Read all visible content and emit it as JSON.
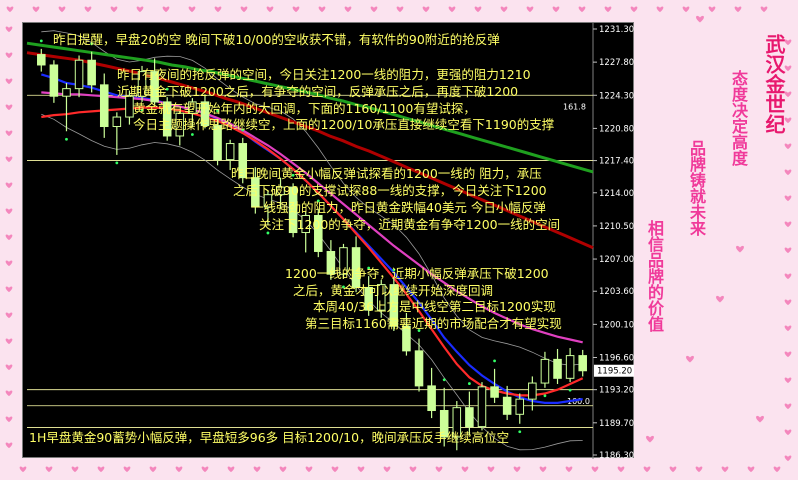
{
  "annotations": {
    "top_line": "昨日提醒，早盘20的空 晚间下破10/00的空收获不错，有软件的90附近的抢反弹",
    "para1": [
      "昨日有夜间的抢反弹的空间，今日关注1200一线的阻力，更强的阻力1210",
      "近期黄金下破1200之后，有争夺的空间，反弹承压之后，再度下破1200",
      "黄金就有望开始年内的大回调，下面的1160/1100有望试探，",
      "今日主题操作思路继续空，上面的1200/10承压直接继续空看下1190的支撑"
    ],
    "para2": [
      "昨日晚间黄金小幅反弹试探看的1200一线的 阻力，承压",
      "之后下破90的支撑试探88一线的支撑，今日关注下1200",
      "一线强劲的阻力，昨日黄金跌幅40美元 今日小幅反弹",
      "关注下1200的争夺，近期黄金有争夺1200一线的空间"
    ],
    "para3": [
      "1200一线的争夺，近期小幅反弹承压下破1200",
      "之后，黄金才可以继续开始深度回调",
      "本周40/36上方是中线空第二目标1200实现",
      "第三目标1160需要近期的市场配合才有望实现"
    ],
    "bottom_line": "1H早盘黄金90蓄势小幅反弹，早盘短多96多 目标1200/10，晚间承压反手继续高位空"
  },
  "slogans": {
    "s1": "武汉金世纪",
    "s2": "态度决定高度",
    "s3": "品牌铸就未来",
    "s4": "相信品牌的价值"
  },
  "colors": {
    "background": "#fbe3ef",
    "chart_bg": "#000000",
    "candle": "#ccff99",
    "bull_fill": "#000000",
    "ma_blue": "#1a2cff",
    "ma_red": "#ff2a2a",
    "ma_magenta": "#e040c0",
    "ma_green": "#1fa01f",
    "ma_darkred": "#b00000",
    "price_line": "#ffff00",
    "slogan_red": "#e8186e",
    "slogan_pink": "#f03a9a"
  },
  "chart_data": {
    "type": "candlestick",
    "timeframe": "1H",
    "y_ticks": [
      "1231.30",
      "1227.80",
      "1224.30",
      "1220.80",
      "1217.40",
      "1214.00",
      "1210.50",
      "1207.00",
      "1203.60",
      "1200.10",
      "1196.60",
      "1193.20",
      "1189.70",
      "1186.30"
    ],
    "ylim": [
      1186.3,
      1231.3
    ],
    "current_price_label": "1195.20",
    "level_label_100": "100.0",
    "level_label_right": "161.8",
    "horizontal_levels": [
      1224.3,
      1217.4,
      1193.2,
      1191.5,
      1189.2
    ],
    "candles": [
      [
        1228.6,
        1229.2,
        1226.8,
        1227.5
      ],
      [
        1227.5,
        1228.0,
        1223.5,
        1224.2
      ],
      [
        1224.2,
        1225.6,
        1220.5,
        1225.0
      ],
      [
        1225.0,
        1228.5,
        1224.1,
        1228.0
      ],
      [
        1228.0,
        1228.9,
        1224.6,
        1225.4
      ],
      [
        1225.4,
        1226.6,
        1219.8,
        1221.0
      ],
      [
        1221.0,
        1222.5,
        1218.0,
        1222.0
      ],
      [
        1222.0,
        1224.8,
        1221.2,
        1224.2
      ],
      [
        1224.2,
        1227.4,
        1223.6,
        1226.8
      ],
      [
        1226.8,
        1228.2,
        1223.3,
        1223.6
      ],
      [
        1223.6,
        1224.1,
        1219.5,
        1220.0
      ],
      [
        1220.0,
        1222.6,
        1219.0,
        1222.4
      ],
      [
        1222.4,
        1224.0,
        1221.0,
        1223.6
      ],
      [
        1223.6,
        1224.4,
        1220.8,
        1221.1
      ],
      [
        1221.1,
        1221.8,
        1216.9,
        1217.5
      ],
      [
        1217.5,
        1219.6,
        1216.4,
        1219.2
      ],
      [
        1219.2,
        1219.8,
        1215.0,
        1215.6
      ],
      [
        1215.6,
        1216.7,
        1211.8,
        1212.5
      ],
      [
        1212.5,
        1214.2,
        1210.6,
        1213.8
      ],
      [
        1213.8,
        1215.6,
        1212.3,
        1214.6
      ],
      [
        1214.6,
        1215.0,
        1209.3,
        1209.8
      ],
      [
        1209.8,
        1212.0,
        1207.7,
        1211.6
      ],
      [
        1211.6,
        1212.3,
        1207.2,
        1207.8
      ],
      [
        1207.8,
        1209.0,
        1204.8,
        1205.4
      ],
      [
        1205.4,
        1208.6,
        1204.9,
        1208.2
      ],
      [
        1208.2,
        1209.4,
        1203.5,
        1204.0
      ],
      [
        1204.0,
        1205.2,
        1201.0,
        1201.6
      ],
      [
        1201.6,
        1204.8,
        1200.8,
        1204.3
      ],
      [
        1204.3,
        1205.0,
        1199.4,
        1199.9
      ],
      [
        1199.9,
        1201.3,
        1196.8,
        1197.3
      ],
      [
        1197.3,
        1198.6,
        1193.0,
        1193.6
      ],
      [
        1193.6,
        1195.5,
        1190.2,
        1191.0
      ],
      [
        1191.0,
        1193.4,
        1187.2,
        1188.2
      ],
      [
        1188.2,
        1192.0,
        1186.8,
        1191.3
      ],
      [
        1191.3,
        1193.0,
        1188.4,
        1189.3
      ],
      [
        1189.3,
        1194.0,
        1188.9,
        1193.5
      ],
      [
        1193.5,
        1195.4,
        1191.8,
        1192.4
      ],
      [
        1192.4,
        1193.6,
        1190.0,
        1190.6
      ],
      [
        1190.6,
        1192.8,
        1189.6,
        1192.2
      ],
      [
        1192.2,
        1194.6,
        1191.0,
        1193.9
      ],
      [
        1193.9,
        1197.2,
        1193.4,
        1196.4
      ],
      [
        1196.4,
        1197.5,
        1193.8,
        1194.4
      ],
      [
        1194.4,
        1197.6,
        1194.0,
        1196.8
      ],
      [
        1196.8,
        1197.4,
        1194.6,
        1195.2
      ]
    ],
    "ma_lines": [
      {
        "name": "MA-blue",
        "color": "#1a2cff",
        "values": [
          1226.5,
          1226.1,
          1225.6,
          1225.4,
          1225.1,
          1224.7,
          1224.3,
          1224.1,
          1224.0,
          1223.8,
          1223.4,
          1223.1,
          1222.8,
          1222.4,
          1221.8,
          1221.2,
          1220.4,
          1219.4,
          1218.5,
          1217.6,
          1216.5,
          1215.3,
          1214.0,
          1212.6,
          1211.2,
          1209.8,
          1208.4,
          1207.0,
          1205.6,
          1204.0,
          1202.4,
          1200.6,
          1198.7,
          1197.2,
          1195.8,
          1194.7,
          1193.8,
          1193.0,
          1192.4,
          1192.0,
          1191.8,
          1191.8,
          1192.0,
          1192.2
        ]
      },
      {
        "name": "MA-red",
        "color": "#ff2a2a",
        "values": [
          1222.0,
          1222.2,
          1222.3,
          1222.5,
          1222.6,
          1222.7,
          1222.8,
          1222.9,
          1223.0,
          1223.0,
          1222.9,
          1222.7,
          1222.4,
          1222.0,
          1221.6,
          1221.0,
          1220.3,
          1219.5,
          1218.6,
          1217.6,
          1216.5,
          1215.3,
          1214.0,
          1212.6,
          1211.2,
          1209.7,
          1208.2,
          1206.6,
          1205.0,
          1203.3,
          1201.5,
          1199.6,
          1197.7,
          1195.9,
          1194.5,
          1193.6,
          1193.1,
          1192.8,
          1192.6,
          1192.6,
          1192.8,
          1193.2,
          1193.8,
          1194.4
        ]
      },
      {
        "name": "MA-magenta",
        "color": "#e040c0",
        "values": [
          1224.6,
          1224.5,
          1224.4,
          1224.4,
          1224.3,
          1224.2,
          1224.1,
          1224.0,
          1223.9,
          1223.7,
          1223.4,
          1223.1,
          1222.8,
          1222.4,
          1221.9,
          1221.3,
          1220.6,
          1219.8,
          1219.0,
          1218.1,
          1217.1,
          1216.1,
          1215.0,
          1213.9,
          1212.8,
          1211.7,
          1210.6,
          1209.5,
          1208.4,
          1207.4,
          1206.4,
          1205.4,
          1204.5,
          1203.6,
          1202.8,
          1202.0,
          1201.3,
          1200.7,
          1200.1,
          1199.6,
          1199.2,
          1198.8,
          1198.5,
          1198.2
        ]
      },
      {
        "name": "MA-green",
        "color": "#1fa01f",
        "values": [
          1229.8,
          1229.6,
          1229.4,
          1229.2,
          1229.0,
          1228.8,
          1228.6,
          1228.4,
          1228.2,
          1228.0,
          1227.8,
          1227.5,
          1227.3,
          1227.0,
          1226.8,
          1226.5,
          1226.2,
          1225.9,
          1225.6,
          1225.3,
          1225.0,
          1224.7,
          1224.4,
          1224.0,
          1223.7,
          1223.3,
          1223.0,
          1222.6,
          1222.2,
          1221.8,
          1221.4,
          1221.0,
          1220.6,
          1220.2,
          1219.8,
          1219.4,
          1219.0,
          1218.6,
          1218.2,
          1217.8,
          1217.4,
          1217.0,
          1216.6,
          1216.2
        ]
      },
      {
        "name": "MA-darkred",
        "color": "#b00000",
        "values": [
          1228.8,
          1228.6,
          1228.4,
          1228.2,
          1228.0,
          1227.7,
          1227.4,
          1227.1,
          1226.8,
          1226.4,
          1226.1,
          1225.7,
          1225.3,
          1224.9,
          1224.5,
          1224.0,
          1223.6,
          1223.1,
          1222.6,
          1222.1,
          1221.6,
          1221.1,
          1220.6,
          1220.0,
          1219.5,
          1218.9,
          1218.4,
          1217.8,
          1217.2,
          1216.6,
          1216.0,
          1215.4,
          1214.8,
          1214.2,
          1213.6,
          1213.0,
          1212.4,
          1211.8,
          1211.2,
          1210.6,
          1210.0,
          1209.4,
          1208.8,
          1208.2
        ]
      }
    ]
  }
}
